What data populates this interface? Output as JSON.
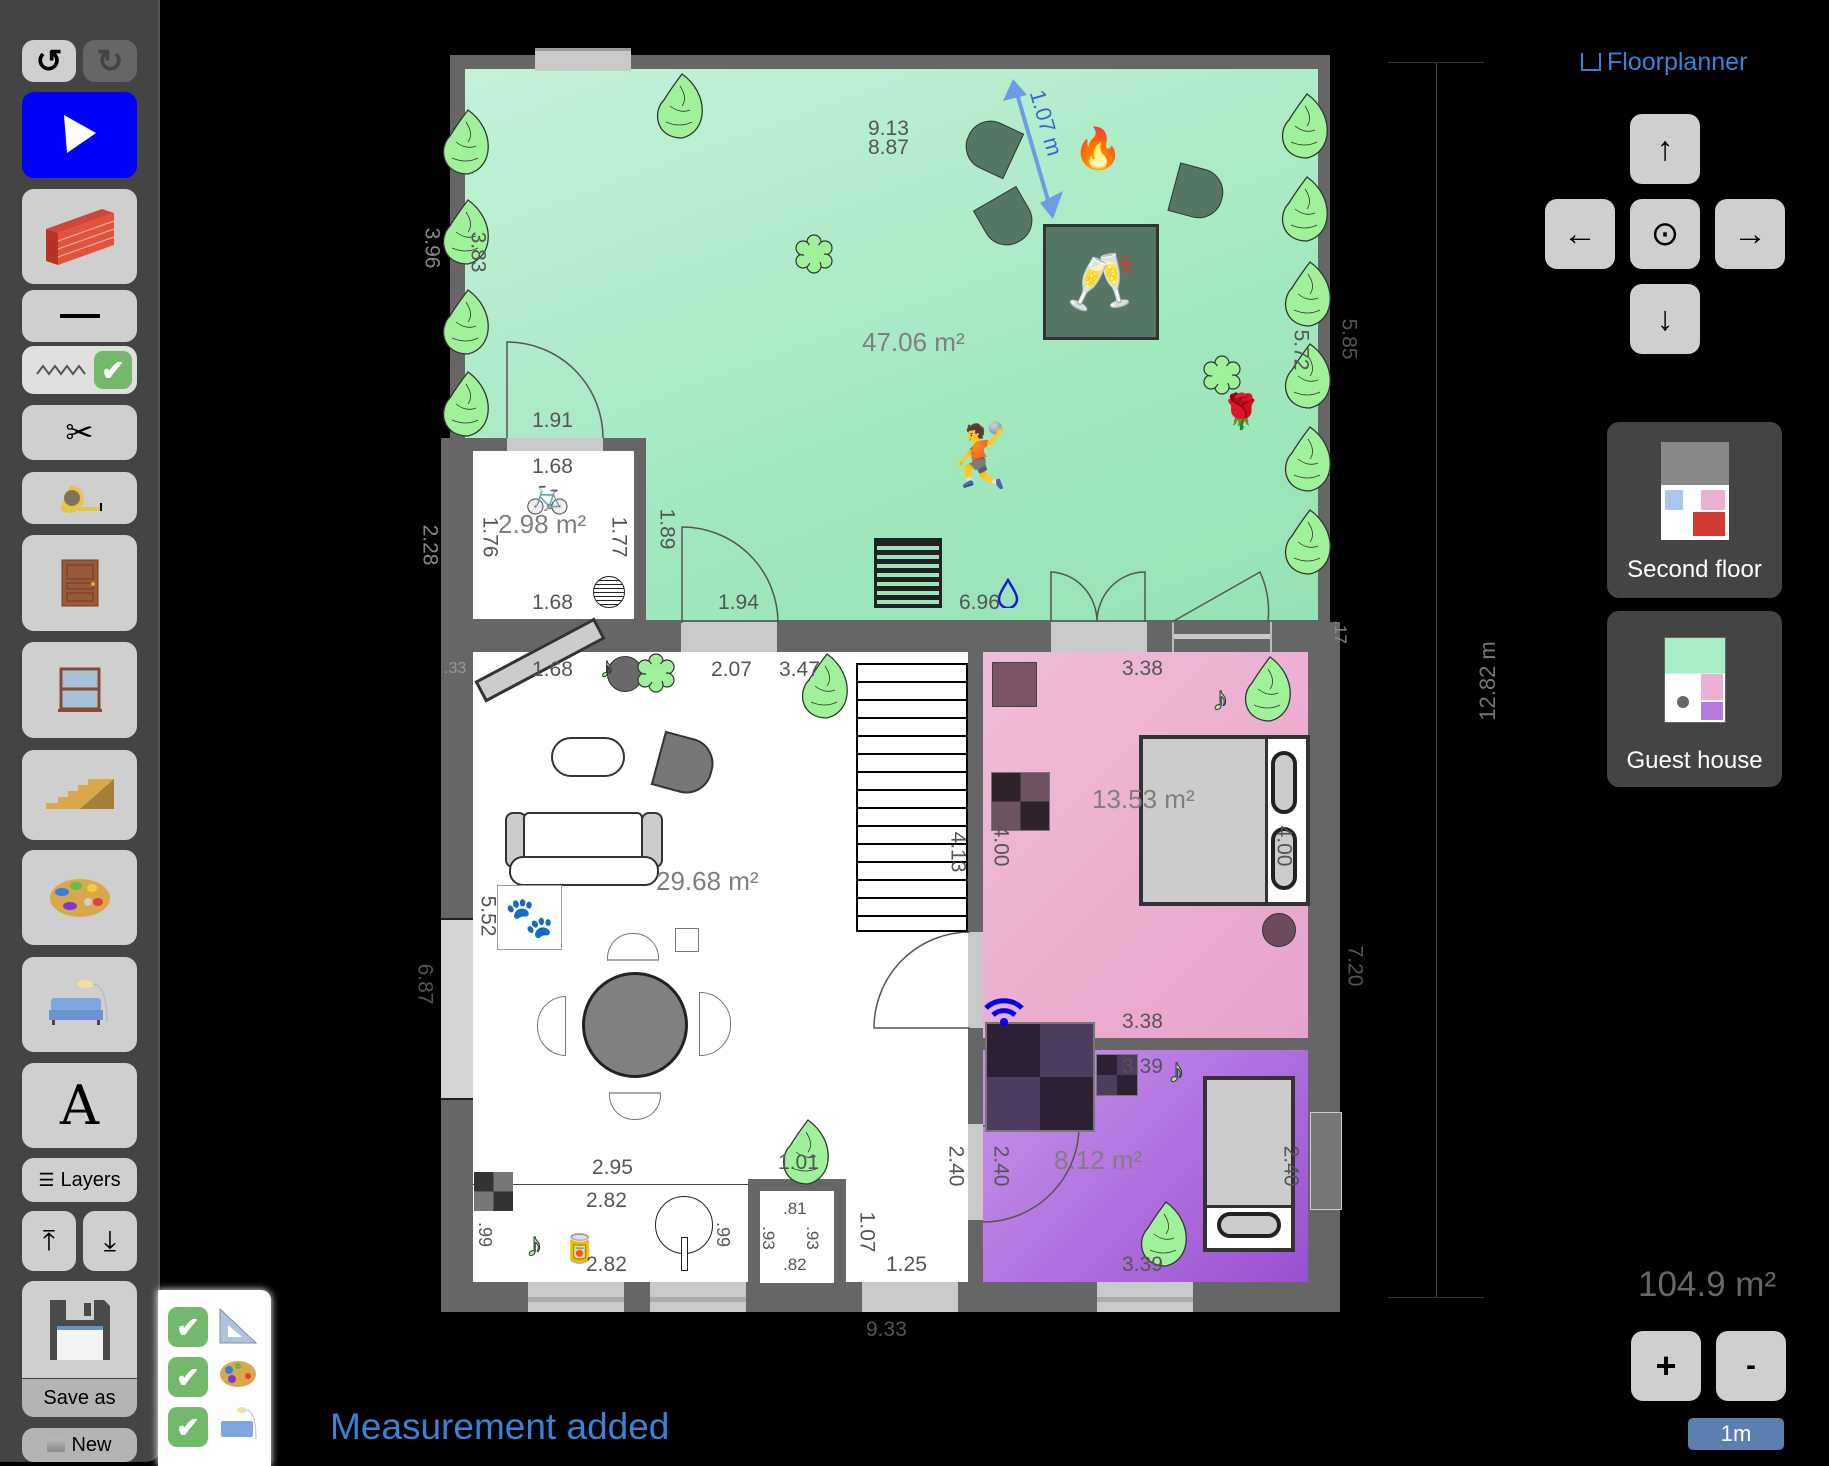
{
  "app": {
    "title": "Floorplanner",
    "home_icon": "house-outline-icon"
  },
  "toolbar": {
    "undo_icon": "↺",
    "redo_icon": "↻",
    "play_icon": "play-icon",
    "wall_tool": "brick-wall-icon",
    "line_tool": "—",
    "zigzag_tool": "zigzag-icon",
    "zigzag_checked": "✔",
    "cut_tool": "✂",
    "measure_tool": "tape-measure-icon",
    "door_tool": "door-icon",
    "window_tool": "window-icon",
    "stairs_tool": "stairs-icon",
    "paint_tool": "palette-icon",
    "furniture_tool": "couch-lamp-icon",
    "text_tool": "A",
    "layers_label": "Layers",
    "layers_icon": "☰",
    "move_top_icon": "⤒",
    "move_bottom_icon": "⤓",
    "save_icon": "floppy-disk-icon",
    "save_as_label": "Save as",
    "new_label": "New",
    "new_icon": "folder-icon"
  },
  "layers_panel": {
    "items": [
      {
        "name": "measurements",
        "checked": true,
        "mark": "✔"
      },
      {
        "name": "colors",
        "checked": true,
        "mark": "✔"
      },
      {
        "name": "furniture",
        "checked": true,
        "mark": "✔"
      }
    ]
  },
  "status": {
    "message": "Measurement added"
  },
  "navigation": {
    "up": "↑",
    "down": "↓",
    "left": "←",
    "right": "→",
    "center": "⊙"
  },
  "floors": [
    {
      "label": "Second floor"
    },
    {
      "label": "Guest house"
    }
  ],
  "total_area": "104.9 m²",
  "zoom": {
    "in": "+",
    "out": "-",
    "scale_label": "1m"
  },
  "plan": {
    "colors": {
      "garden": "#a8ecc4",
      "pink": "#eab0d4",
      "purple": "#b679e0",
      "wall": "#666666",
      "floor": "#ffffff"
    },
    "rooms": [
      {
        "name": "garden",
        "area": "47.06 m²"
      },
      {
        "name": "bike-storage",
        "area": "2.98 m²"
      },
      {
        "name": "living-room",
        "area": "29.68 m²"
      },
      {
        "name": "bedroom",
        "area": "13.53 m²"
      },
      {
        "name": "bathroom",
        "area": "8.12 m²"
      }
    ],
    "labels": {
      "g_top1": "9.13",
      "g_top2": "8.87",
      "g_left_out": "3.96",
      "g_left_in": "3.83",
      "g_right_out": "5.85",
      "g_right_in": "5.72",
      "g_door": "1.91",
      "g_door2": "1.94",
      "g_bottom": "6.96",
      "bike_top": "1.68",
      "bike_bottom": "1.68",
      "bike_left": "1.76",
      "bike_right": "1.77",
      "bike_outer_left": "2.28",
      "bike_gap": "1.89",
      "corner_17": ".17",
      "corner_33": ".33",
      "living_top1": "1.68",
      "living_top2": "2.07",
      "living_top3": "3.47",
      "stair_len": "4.13",
      "living_left": "5.52",
      "outer_left": "6.87",
      "kitchen_top": "2.95",
      "kitchen_in_top": "2.82",
      "kitchen_in_bottom": "2.82",
      "kitchen_left": ".99",
      "kitchen_right": ".99",
      "wc_top": ".81",
      "wc_bottom": ".82",
      "wc_left": ".93",
      "wc_right": ".93",
      "hall_101": "1.01",
      "hall_107": "1.07",
      "hall_125": "1.25",
      "hall_240": "2.40",
      "bottom_outer": "9.33",
      "bed_top": "3.38",
      "bed_bottom": "3.38",
      "bed_left": "4.00",
      "bed_right": "4.00",
      "bath_top": "3.39",
      "bath_bottom": "3.39",
      "bath_left": "2.40",
      "bath_right": "2.40",
      "outer_right": "7.20",
      "total_height": "12.82 m",
      "measure": "1.07 m"
    },
    "objects": {
      "plant": "monstera-plant-icon",
      "shrub": "shrub-icon",
      "fire": "🔥",
      "cheers": "🥂",
      "player": "🤾",
      "rose": "🌹",
      "bike": "🚲",
      "paw": "🐾",
      "note": "♪",
      "drop": "water-drop-icon",
      "wifi": "wifi-icon",
      "can": "🥫"
    }
  }
}
